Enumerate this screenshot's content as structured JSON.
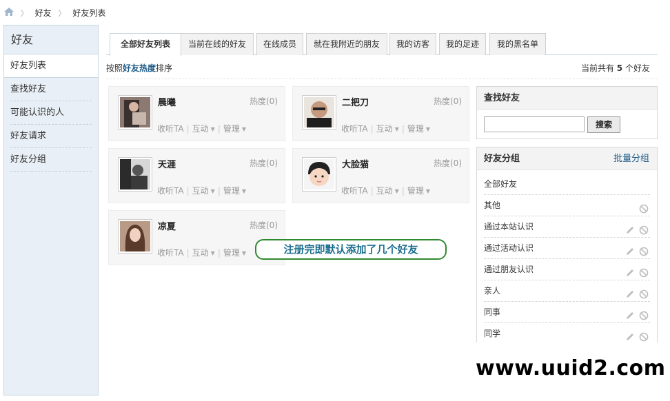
{
  "breadcrumb": {
    "items": [
      "好友",
      "好友列表"
    ]
  },
  "sidebar": {
    "title": "好友",
    "items": [
      {
        "label": "好友列表",
        "active": true
      },
      {
        "label": "查找好友"
      },
      {
        "label": "可能认识的人"
      },
      {
        "label": "好友请求"
      },
      {
        "label": "好友分组"
      }
    ]
  },
  "tabs": [
    {
      "label": "全部好友列表",
      "active": true
    },
    {
      "label": "当前在线的好友"
    },
    {
      "label": "在线成员"
    },
    {
      "label": "就在我附近的朋友"
    },
    {
      "label": "我的访客"
    },
    {
      "label": "我的足迹"
    },
    {
      "label": "我的黑名单"
    }
  ],
  "sort": {
    "prefix": "按照",
    "key": "好友热度",
    "suffix": "排序"
  },
  "count": {
    "prefix": "当前共有",
    "value": "5",
    "suffix": "个好友"
  },
  "friends": [
    {
      "name": "晨曦",
      "heat": "热度(0)",
      "follow": "收听TA",
      "interact": "互动",
      "manage": "管理"
    },
    {
      "name": "二把刀",
      "heat": "热度(0)",
      "follow": "收听TA",
      "interact": "互动",
      "manage": "管理"
    },
    {
      "name": "天涯",
      "heat": "热度(0)",
      "follow": "收听TA",
      "interact": "互动",
      "manage": "管理"
    },
    {
      "name": "大脸猫",
      "heat": "热度(0)",
      "follow": "收听TA",
      "interact": "互动",
      "manage": "管理"
    },
    {
      "name": "凉夏",
      "heat": "热度(0)",
      "follow": "收听TA",
      "interact": "互动",
      "manage": "管理"
    }
  ],
  "annotation": "注册完即默认添加了几个好友",
  "find_panel": {
    "title": "查找好友",
    "input_value": "",
    "button": "搜索"
  },
  "group_panel": {
    "title": "好友分组",
    "action": "批量分组",
    "groups": [
      {
        "label": "全部好友",
        "edit": false,
        "delete": false
      },
      {
        "label": "其他",
        "edit": false,
        "delete": true
      },
      {
        "label": "通过本站认识",
        "edit": true,
        "delete": true
      },
      {
        "label": "通过活动认识",
        "edit": true,
        "delete": true
      },
      {
        "label": "通过朋友认识",
        "edit": true,
        "delete": true
      },
      {
        "label": "亲人",
        "edit": true,
        "delete": true
      },
      {
        "label": "同事",
        "edit": true,
        "delete": true
      },
      {
        "label": "同学",
        "edit": true,
        "delete": true
      }
    ]
  },
  "watermark": "www.uuid2.com",
  "colors": {
    "link": "#1d5a86",
    "sidebar_bg": "#e8eff6",
    "note_border": "#2f8a2f"
  }
}
